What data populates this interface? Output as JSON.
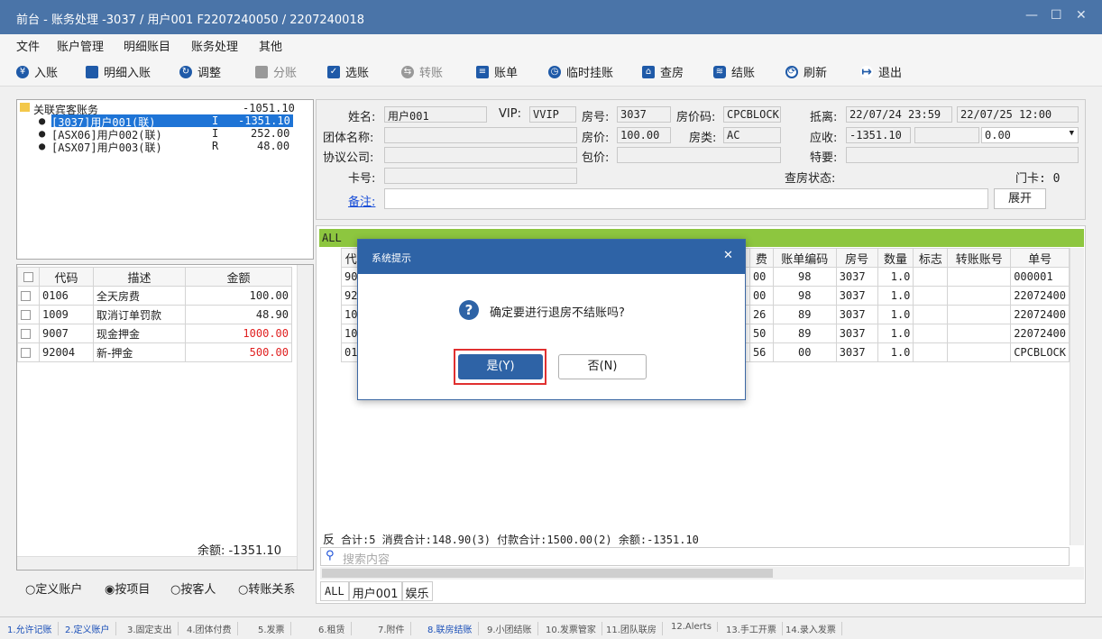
{
  "window": {
    "title": "前台 - 账务处理 -3037 / 用户001 F2207240050 / 2207240018"
  },
  "menu": [
    "文件",
    "账户管理",
    "明细账目",
    "账务处理",
    "其他"
  ],
  "toolbar": [
    {
      "label": "入账",
      "icon": "yen-circle-icon",
      "enabled": true
    },
    {
      "label": "明细入账",
      "icon": "monitor-icon",
      "enabled": true
    },
    {
      "label": "调整",
      "icon": "adjust-icon",
      "enabled": true
    },
    {
      "label": "分账",
      "icon": "split-icon",
      "enabled": false
    },
    {
      "label": "选账",
      "icon": "check-box-icon",
      "enabled": true
    },
    {
      "label": "转账",
      "icon": "transfer-icon",
      "enabled": false
    },
    {
      "label": "账单",
      "icon": "document-icon",
      "enabled": true
    },
    {
      "label": "临时挂账",
      "icon": "clock-icon",
      "enabled": true
    },
    {
      "label": "查房",
      "icon": "house-icon",
      "enabled": true
    },
    {
      "label": "结账",
      "icon": "coins-icon",
      "enabled": true
    },
    {
      "label": "刷新",
      "icon": "refresh-icon",
      "enabled": true
    },
    {
      "label": "退出",
      "icon": "exit-icon",
      "enabled": true
    }
  ],
  "tree": {
    "root": {
      "label": "关联宾客账务",
      "amount": "-1051.10"
    },
    "items": [
      {
        "label": "[3037]用户001(联)",
        "flag": "I",
        "amount": "-1351.10",
        "selected": true
      },
      {
        "label": "[ASX06]用户002(联)",
        "flag": "I",
        "amount": "252.00"
      },
      {
        "label": "[ASX07]用户003(联)",
        "flag": "R",
        "amount": "48.00"
      }
    ]
  },
  "items_table": {
    "headers": [
      "代码",
      "描述",
      "金额"
    ],
    "rows": [
      {
        "code": "0106",
        "desc": "全天房费",
        "amount": "100.00",
        "red": false
      },
      {
        "code": "1009",
        "desc": "取消订单罚款",
        "amount": "48.90",
        "red": false
      },
      {
        "code": "9007",
        "desc": "现金押金",
        "amount": "1000.00",
        "red": true
      },
      {
        "code": "92004",
        "desc": "新-押金",
        "amount": "500.00",
        "red": true
      }
    ],
    "balance": "余额: -1351.10"
  },
  "view_options": [
    {
      "label": "定义账户",
      "checked": false
    },
    {
      "label": "按项目",
      "checked": true
    },
    {
      "label": "按客人",
      "checked": false
    },
    {
      "label": "转账关系",
      "checked": false
    }
  ],
  "guest": {
    "name_label": "姓名:",
    "name": "用户001",
    "vip_label": "VIP:",
    "vip": "VVIP",
    "room_label": "房号:",
    "room": "3037",
    "rate_code_label": "房价码:",
    "rate_code": "CPCBLOCK",
    "departure_label": "抵离:",
    "arrival": "22/07/24 23:59",
    "departure": "22/07/25 12:00",
    "group_label": "团体名称:",
    "price_label": "房价:",
    "price": "100.00",
    "room_type_label": "房类:",
    "room_type": "AC",
    "receivable_label": "应收:",
    "receivable": "-1351.10",
    "receivable_extra": "0.00",
    "agreement_label": "协议公司:",
    "package_label": "包价:",
    "special_label": "特要:",
    "card_label": "卡号:",
    "inspect_label": "查房状态:",
    "door_card": "门卡: 0",
    "remark_label": "备注:",
    "expand_button": "展开"
  },
  "tx_table": {
    "filter": "ALL",
    "headers": [
      "代",
      "费",
      "账单编码",
      "房号",
      "数量",
      "标志",
      "转账账号",
      "单号"
    ],
    "rows": [
      {
        "code": "90",
        "fee": "00",
        "bill": "98",
        "room": "3037",
        "qty": "1.0",
        "flag": "",
        "transfer": "",
        "no": "000001"
      },
      {
        "code": "92",
        "fee": "00",
        "bill": "98",
        "room": "3037",
        "qty": "1.0",
        "flag": "",
        "transfer": "",
        "no": "22072400"
      },
      {
        "code": "10",
        "fee": "26",
        "bill": "89",
        "room": "3037",
        "qty": "1.0",
        "flag": "",
        "transfer": "",
        "no": "22072400"
      },
      {
        "code": "10",
        "fee": "50",
        "bill": "89",
        "room": "3037",
        "qty": "1.0",
        "flag": "",
        "transfer": "",
        "no": "22072400"
      },
      {
        "code": "01",
        "fee": "56",
        "bill": "00",
        "room": "3037",
        "qty": "1.0",
        "flag": "",
        "transfer": "",
        "no": "CPCBLOCK"
      }
    ],
    "summary_prefix": "反",
    "summary": "合计:5  消费合计:148.90(3)  付款合计:1500.00(2)  余额:-1351.10",
    "search_placeholder": "搜索内容",
    "bottom_tabs": [
      "ALL",
      "用户001",
      "娱乐"
    ]
  },
  "bottom_tabs": [
    {
      "label": "1.允许记账",
      "active": true
    },
    {
      "label": "2.定义账户",
      "active": true
    },
    {
      "label": "3.固定支出",
      "active": false
    },
    {
      "label": "4.团体付费",
      "active": false
    },
    {
      "label": "5.发票",
      "active": false
    },
    {
      "label": "6.租赁",
      "active": false
    },
    {
      "label": "7.附件",
      "active": false
    },
    {
      "label": "8.联房结账",
      "active": true
    },
    {
      "label": "9.小团结账",
      "active": false
    },
    {
      "label": "10.发票管家",
      "active": false
    },
    {
      "label": "11.团队联房",
      "active": false
    },
    {
      "label": "12.Alerts",
      "active": false
    },
    {
      "label": "13.手工开票",
      "active": false
    },
    {
      "label": "14.录入发票",
      "active": false
    }
  ],
  "dialog": {
    "title": "系统提示",
    "message": "确定要进行退房不结账吗?",
    "yes": "是(Y)",
    "no": "否(N)"
  },
  "colors": {
    "titlebar": "#4a74a8",
    "dialog_title": "#2e63a6",
    "highlight_green": "#8dc63f",
    "selection": "#1e74d6",
    "red_amount": "#e02020",
    "focus_box": "#e03030"
  }
}
